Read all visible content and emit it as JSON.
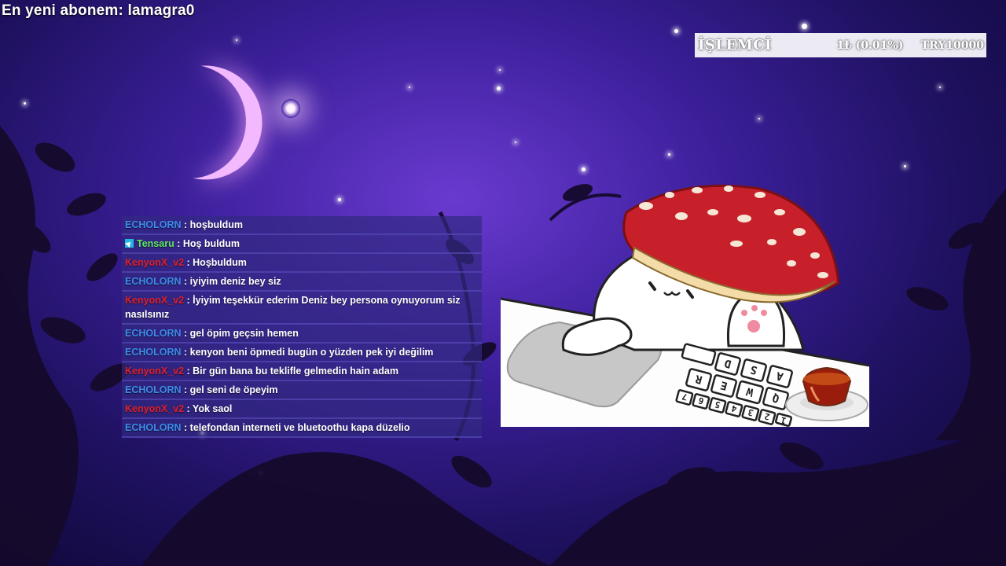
{
  "overlay": {
    "subscriber_text": "En yeni abonem: lamagra0"
  },
  "cpu": {
    "label": "İŞLEMCİ",
    "usage": "1₺ (0.01%)",
    "price": "TRY10000"
  },
  "chat": {
    "messages": [
      {
        "user": "ECHOLORN",
        "user_color": "#3b8de8",
        "badge": false,
        "text": ": hoşbuldum"
      },
      {
        "user": "Tensaru",
        "user_color": "#5ee85e",
        "badge": true,
        "text": ": Hoş buldum"
      },
      {
        "user": "KenyonX_v2",
        "user_color": "#e0202a",
        "badge": false,
        "text": ": Hoşbuldum"
      },
      {
        "user": "ECHOLORN",
        "user_color": "#3b8de8",
        "badge": false,
        "text": ": iyiyim deniz bey siz"
      },
      {
        "user": "KenyonX_v2",
        "user_color": "#e0202a",
        "badge": false,
        "text": ": İyiyim teşekkür ederim Deniz bey persona oynuyorum siz nasılsınız"
      },
      {
        "user": "ECHOLORN",
        "user_color": "#3b8de8",
        "badge": false,
        "text": ": gel öpim geçsin hemen"
      },
      {
        "user": "ECHOLORN",
        "user_color": "#3b8de8",
        "badge": false,
        "text": ": kenyon beni öpmedi bugün o yüzden pek iyi değilim"
      },
      {
        "user": "KenyonX_v2",
        "user_color": "#e0202a",
        "badge": false,
        "text": ": Bir gün bana bu teklifle gelmedin hain adam"
      },
      {
        "user": "ECHOLORN",
        "user_color": "#3b8de8",
        "badge": false,
        "text": ": gel seni de öpeyim"
      },
      {
        "user": "KenyonX_v2",
        "user_color": "#e0202a",
        "badge": false,
        "text": ": Yok saol"
      },
      {
        "user": "ECHOLORN",
        "user_color": "#3b8de8",
        "badge": false,
        "text": ": telefondan interneti ve bluetoothu kapa düzelio"
      }
    ]
  },
  "keyboard": {
    "keys": [
      "A",
      "S",
      "D",
      "Q",
      "W",
      "E",
      "R",
      "1",
      "2",
      "3",
      "4",
      "5",
      "6",
      "7"
    ]
  },
  "colors": {
    "accent_blue": "#3b8de8",
    "accent_green": "#5ee85e",
    "accent_red": "#e0202a",
    "mushroom_red": "#c8202a"
  }
}
